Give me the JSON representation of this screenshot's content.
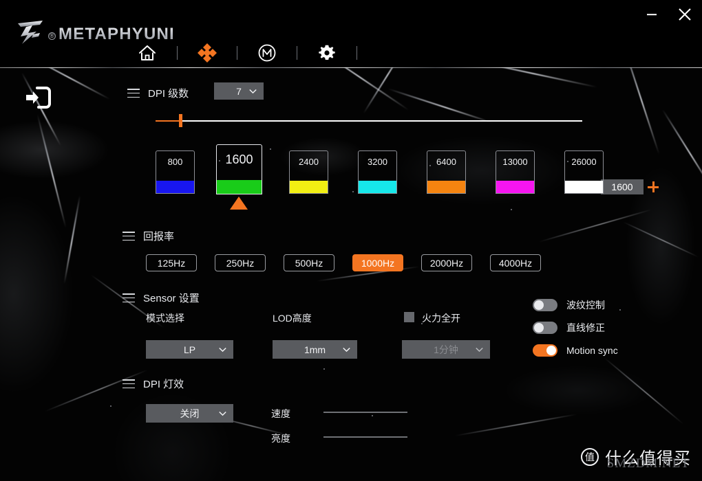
{
  "window": {
    "minimize_label": "—",
    "close_label": "✕"
  },
  "brand": {
    "name": "METAPHYUNI",
    "registered_mark": "®",
    "logo_icon": "xuan-glyph-logo"
  },
  "nav": {
    "items": [
      {
        "name": "home",
        "icon": "home-icon",
        "active": false
      },
      {
        "name": "dpi",
        "icon": "dpi-crosshair-icon",
        "active": true
      },
      {
        "name": "macro",
        "icon": "macro-m-icon",
        "active": false
      },
      {
        "name": "settings",
        "icon": "gear-icon",
        "active": false
      }
    ]
  },
  "back_button": {
    "icon": "back-arrow-icon"
  },
  "dpi_levels": {
    "title": "DPI 级数",
    "count_value": "7",
    "menu_icon": "hamburger-icon"
  },
  "dpi_slider": {
    "current_value": "1600",
    "minus_label": "−",
    "plus_label": "+",
    "fill_percent": 5.8
  },
  "dpi_stages": [
    {
      "value": "800",
      "color": "#1816f0",
      "active": false
    },
    {
      "value": "1600",
      "color": "#19cc19",
      "active": true
    },
    {
      "value": "2400",
      "color": "#f2ef13",
      "active": false
    },
    {
      "value": "3200",
      "color": "#16e8ea",
      "active": false
    },
    {
      "value": "6400",
      "color": "#f58410",
      "active": false
    },
    {
      "value": "13000",
      "color": "#f515f0",
      "active": false
    },
    {
      "value": "26000",
      "color": "#ffffff",
      "active": false
    }
  ],
  "polling_rate": {
    "title": "回报率",
    "menu_icon": "hamburger-icon",
    "options": [
      {
        "label": "125Hz",
        "active": false
      },
      {
        "label": "250Hz",
        "active": false
      },
      {
        "label": "500Hz",
        "active": false
      },
      {
        "label": "1000Hz",
        "active": true
      },
      {
        "label": "2000Hz",
        "active": false
      },
      {
        "label": "4000Hz",
        "active": false
      }
    ]
  },
  "sensor": {
    "title": "Sensor 设置",
    "menu_icon": "hamburger-icon",
    "mode_label": "模式选择",
    "mode_value": "LP",
    "lod_label": "LOD高度",
    "lod_value": "1mm",
    "full_power_label": "火力全开",
    "full_power_checked": false,
    "sleep_value": "1分钟",
    "sleep_disabled": true,
    "toggles": [
      {
        "label": "波纹控制",
        "on": false
      },
      {
        "label": "直线修正",
        "on": false
      },
      {
        "label": "Motion sync",
        "on": true
      }
    ]
  },
  "dpi_light": {
    "title": "DPI 灯效",
    "menu_icon": "hamburger-icon",
    "effect_value": "关闭",
    "speed_label": "速度",
    "brightness_label": "亮度"
  },
  "watermark": {
    "badge": "值",
    "text": "什么值得买",
    "overlay": "SMZDM.NET"
  },
  "colors": {
    "accent": "#f47521",
    "panel": "#595b5f",
    "text": "#e8eaee"
  }
}
